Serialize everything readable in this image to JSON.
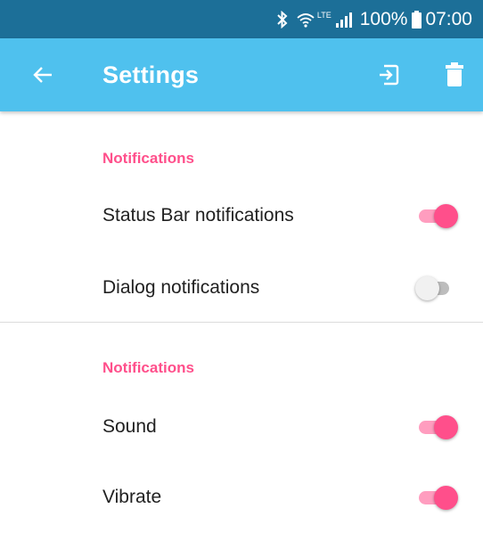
{
  "status_bar": {
    "battery": "100%",
    "time": "07:00",
    "network": "LTE",
    "icons": [
      "bluetooth-icon",
      "wifi-icon",
      "signal-icon",
      "battery-icon"
    ]
  },
  "app_bar": {
    "title": "Settings",
    "back_icon": "arrow-back-icon",
    "actions": [
      "import-icon",
      "delete-icon"
    ]
  },
  "sections": [
    {
      "header": "Notifications",
      "items": [
        {
          "label": "Status Bar notifications",
          "enabled": true
        },
        {
          "label": "Dialog notifications",
          "enabled": false
        }
      ]
    },
    {
      "header": "Notifications",
      "items": [
        {
          "label": "Sound",
          "enabled": true
        },
        {
          "label": "Vibrate",
          "enabled": true
        }
      ]
    }
  ],
  "colors": {
    "status_bar": "#1c6f98",
    "app_bar": "#4fc1ee",
    "accent": "#ff4f8b",
    "accent_track": "#ff9dbf",
    "switch_off_thumb": "#f1f1f1",
    "switch_off_track": "#bdbdbd"
  }
}
